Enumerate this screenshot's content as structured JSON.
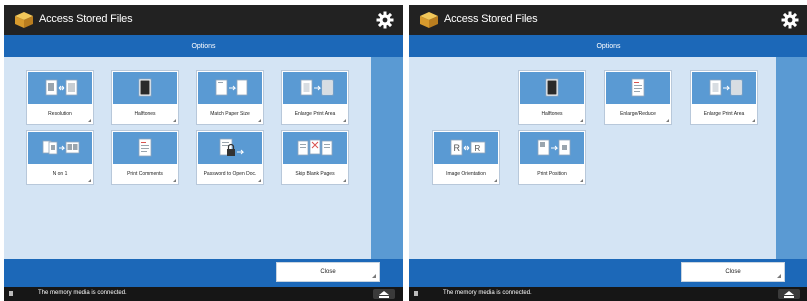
{
  "panels": [
    {
      "title": "Access Stored Files",
      "options_label": "Options",
      "buttons": [
        {
          "label": "Resolution",
          "icon": "resolution-icon"
        },
        {
          "label": "Halftones",
          "icon": "halftones-icon"
        },
        {
          "label": "Match Paper Size",
          "icon": "match-paper-size-icon"
        },
        {
          "label": "Enlarge Print Area",
          "icon": "enlarge-print-area-icon"
        },
        {
          "label": "N on 1",
          "icon": "n-on-1-icon"
        },
        {
          "label": "Print Comments",
          "icon": "print-comments-icon"
        },
        {
          "label": "Password to Open Doc.",
          "icon": "password-lock-icon"
        },
        {
          "label": "Skip Blank Pages",
          "icon": "skip-blank-pages-icon"
        }
      ],
      "close_label": "Close",
      "status_message": "The memory media is connected."
    },
    {
      "title": "Access Stored Files",
      "options_label": "Options",
      "buttons": [
        {
          "label": "Halftones",
          "icon": "halftones-icon"
        },
        {
          "label": "Enlarge/Reduce",
          "icon": "enlarge-reduce-icon"
        },
        {
          "label": "Enlarge Print Area",
          "icon": "enlarge-print-area-icon"
        },
        {
          "label": "Image Orientation",
          "icon": "image-orientation-icon"
        },
        {
          "label": "Print Position",
          "icon": "print-position-icon"
        }
      ],
      "close_label": "Close",
      "status_message": "The memory media is connected."
    }
  ],
  "colors": {
    "title_bar": "#222222",
    "options_bar": "#1c68b8",
    "grid_background": "#d4e4f4",
    "side_strip": "#5a9ad3",
    "icon_tile": "#5a9ad3",
    "status_bar": "#161616"
  }
}
